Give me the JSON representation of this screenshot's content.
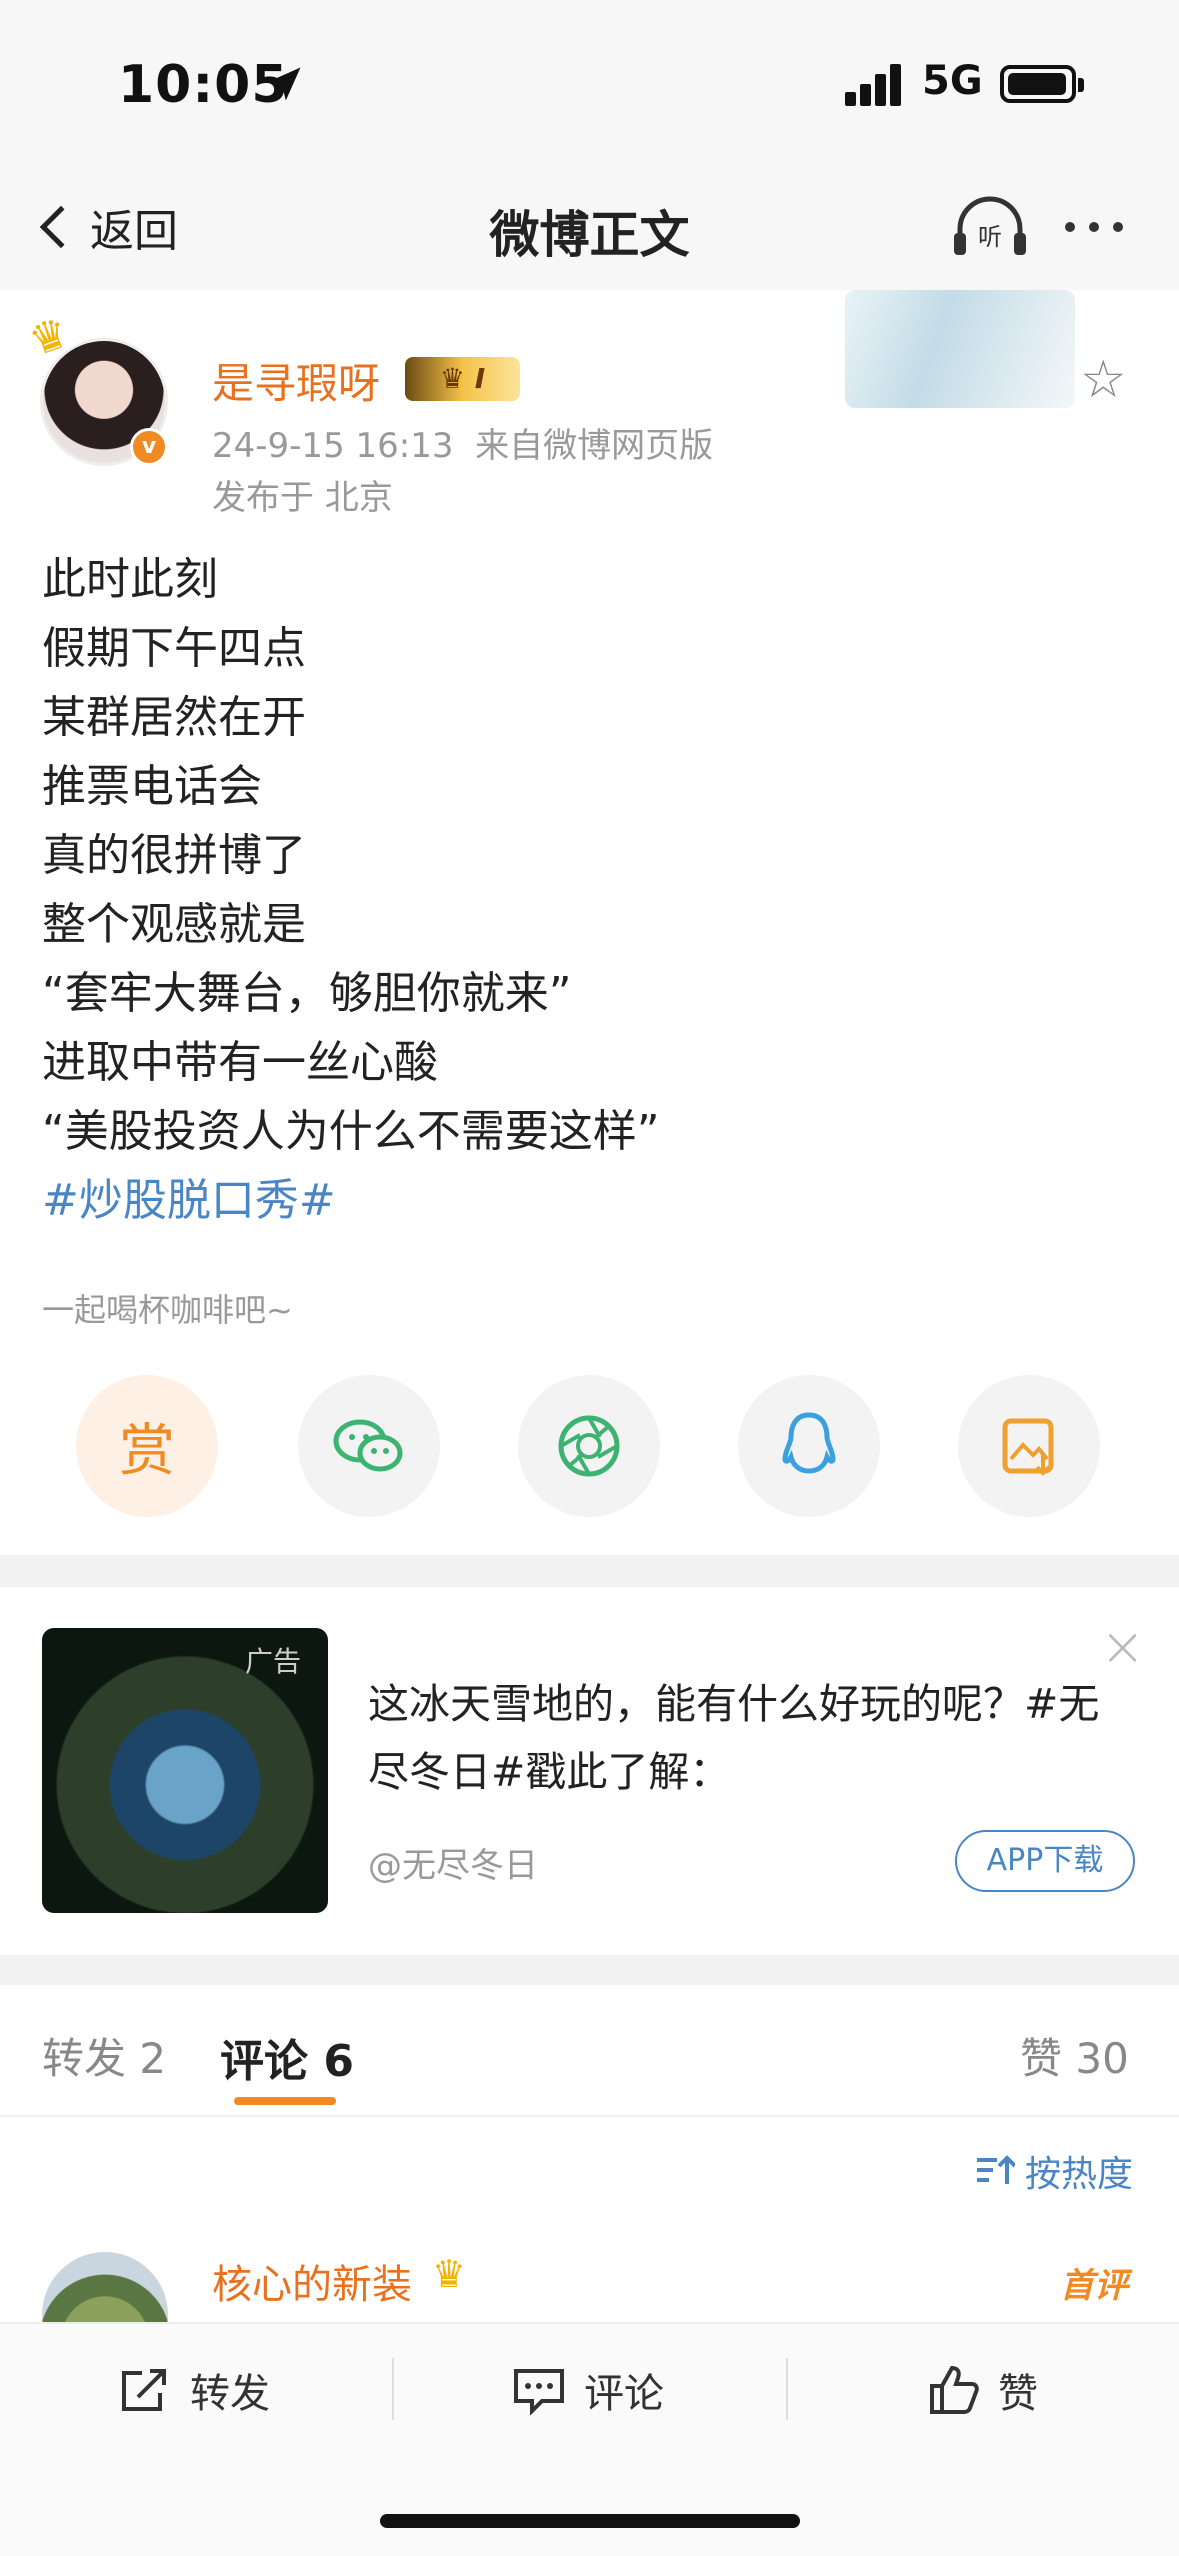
{
  "status": {
    "time": "10:05",
    "network": "5G"
  },
  "nav": {
    "back_label": "返回",
    "title": "微博正文",
    "listen_label": "听"
  },
  "post": {
    "username": "是寻瑕呀",
    "vip_level": "I",
    "timestamp": "24-9-15 16:13",
    "source": "来自微博网页版",
    "location": "发布于 北京",
    "lines": [
      "此时此刻",
      "假期下午四点",
      "某群居然在开",
      "推票电话会",
      "真的很拼博了",
      "整个观感就是",
      "“套牢大舞台，够胆你就来”",
      "进取中带有一丝心酸",
      "“美股投资人为什么不需要这样”"
    ],
    "topic": "#炒股脱口秀#",
    "reward_prompt": "一起喝杯咖啡吧~",
    "reward_label": "赏"
  },
  "ad": {
    "tag": "广告",
    "text": "这冰天雪地的，能有什么好玩的呢？#无尽冬日#戳此了解：",
    "source": "@无尽冬日",
    "button": "APP下载"
  },
  "tabs": {
    "repost": "转发 2",
    "comment": "评论 6",
    "like": "赞 30"
  },
  "sort_label": "按热度",
  "first_comment": {
    "username": "核心的新装",
    "badge": "首评"
  },
  "toolbar": {
    "repost": "转发",
    "comment": "评论",
    "like": "赞"
  },
  "colors": {
    "accent": "#f08a23",
    "link": "#4a86c5",
    "username": "#e8711f"
  }
}
